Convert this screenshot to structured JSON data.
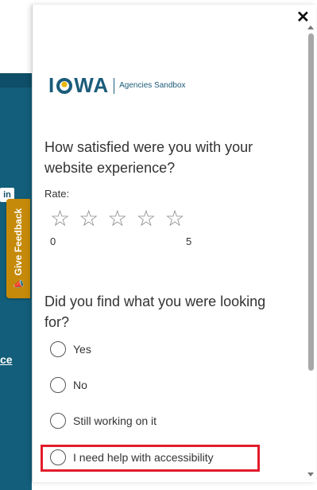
{
  "background": {
    "social_icon": "in",
    "link_fragment": "ce",
    "feedback_tab_label": "Give Feedback"
  },
  "panel": {
    "close_label": "✕",
    "logo": {
      "word_left": "I",
      "word_right": "WA",
      "subtitle": "Agencies Sandbox"
    },
    "question1": "How satisfied were you with your website experience?",
    "rate_label": "Rate:",
    "stars": [
      "☆",
      "☆",
      "☆",
      "☆",
      "☆"
    ],
    "scale_min": "0",
    "scale_max": "5",
    "question2": "Did you find what you were looking for?",
    "options": [
      "Yes",
      "No",
      "Still working on it",
      "I need help with accessibility"
    ]
  },
  "colors": {
    "accent_teal": "#135e7a",
    "feedback_gold": "#c58a0a",
    "highlight_red": "#e11d2b"
  }
}
